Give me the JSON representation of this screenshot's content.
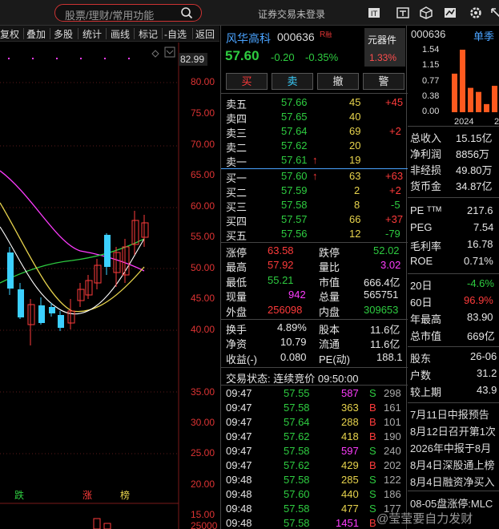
{
  "topbar": {
    "search_placeholder": "股票/理财/常用功能",
    "login_status": "证券交易未登录",
    "icons": [
      "brand-icon",
      "text-icon",
      "cube-icon",
      "chart-icon",
      "settings-icon",
      "expand-icon"
    ]
  },
  "chart_toolbar": {
    "items": [
      "复权",
      "叠加",
      "多股",
      "统计",
      "画线",
      "标记",
      "-自选",
      "返回"
    ]
  },
  "chart": {
    "top_price": "82.99",
    "price_labels": [
      "80.00",
      "75.00",
      "70.00",
      "65.00",
      "60.00",
      "55.00",
      "50.00",
      "45.00",
      "40.00",
      "35.00",
      "30.00",
      "25.00",
      "20.00",
      "15.00"
    ],
    "volume_label": "25000",
    "markers": {
      "die": "跌",
      "zhang": "涨",
      "bang": "榜"
    }
  },
  "quote": {
    "name": "风华高科",
    "code": "000636",
    "badge": "R",
    "sector_name": "元器件",
    "sector_pct": "1.33%",
    "price": "57.60",
    "change": "-0.20",
    "change_pct": "-0.35%",
    "actions": [
      "买",
      "卖",
      "撤",
      "警"
    ],
    "sell": [
      {
        "label": "卖五",
        "price": "57.66",
        "vol": "45",
        "delta": "+45"
      },
      {
        "label": "卖四",
        "price": "57.65",
        "vol": "40",
        "delta": ""
      },
      {
        "label": "卖三",
        "price": "57.64",
        "vol": "69",
        "delta": "+2"
      },
      {
        "label": "卖二",
        "price": "57.62",
        "vol": "20",
        "delta": ""
      },
      {
        "label": "卖一",
        "price": "57.61",
        "vol": "19",
        "delta": ""
      }
    ],
    "buy": [
      {
        "label": "买一",
        "price": "57.60",
        "vol": "63",
        "delta": "+63"
      },
      {
        "label": "买二",
        "price": "57.59",
        "vol": "2",
        "delta": "+2"
      },
      {
        "label": "买三",
        "price": "57.58",
        "vol": "8",
        "delta": "-5"
      },
      {
        "label": "买四",
        "price": "57.57",
        "vol": "66",
        "delta": "+37"
      },
      {
        "label": "买五",
        "price": "57.56",
        "vol": "12",
        "delta": "-79"
      }
    ],
    "stats": [
      {
        "l1": "涨停",
        "v1": "63.58",
        "l2": "跌停",
        "v2": "52.02"
      },
      {
        "l1": "最高",
        "v1": "57.92",
        "l2": "量比",
        "v2": "3.02"
      },
      {
        "l1": "最低",
        "v1": "55.21",
        "l2": "市值",
        "v2": "666.4亿"
      },
      {
        "l1": "现量",
        "v1": "942",
        "l2": "总量",
        "v2": "565751"
      },
      {
        "l1": "外盘",
        "v1": "256098",
        "l2": "内盘",
        "v2": "309653"
      }
    ],
    "stats2": [
      {
        "l1": "换手",
        "v1": "4.89%",
        "l2": "股本",
        "v2": "11.6亿"
      },
      {
        "l1": "净资",
        "v1": "10.79",
        "l2": "流通",
        "v2": "11.6亿"
      },
      {
        "l1": "收益(-)",
        "v1": "0.080",
        "l2": "PE(动)",
        "v2": "188.1"
      }
    ],
    "trade_status": "交易状态: 连续竞价 09:50:00",
    "ticks": [
      {
        "t": "09:47",
        "p": "57.55",
        "v": "587",
        "s": "S",
        "n": "298"
      },
      {
        "t": "09:47",
        "p": "57.58",
        "v": "363",
        "s": "B",
        "n": "161"
      },
      {
        "t": "09:47",
        "p": "57.64",
        "v": "288",
        "s": "B",
        "n": "101"
      },
      {
        "t": "09:47",
        "p": "57.62",
        "v": "418",
        "s": "B",
        "n": "190"
      },
      {
        "t": "09:47",
        "p": "57.58",
        "v": "597",
        "s": "S",
        "n": "240"
      },
      {
        "t": "09:47",
        "p": "57.62",
        "v": "429",
        "s": "B",
        "n": "202"
      },
      {
        "t": "09:48",
        "p": "57.58",
        "v": "285",
        "s": "S",
        "n": "122"
      },
      {
        "t": "09:48",
        "p": "57.60",
        "v": "440",
        "s": "S",
        "n": "186"
      },
      {
        "t": "09:48",
        "p": "57.58",
        "v": "477",
        "s": "S",
        "n": "177"
      },
      {
        "t": "09:48",
        "p": "57.58",
        "v": "1451",
        "s": "B",
        "n": ""
      }
    ]
  },
  "right": {
    "code": "000636",
    "period": "单季",
    "bar_labels": [
      "1.54",
      "1.15",
      "0.77",
      "0.38",
      "0.00"
    ],
    "bar_values": [
      0.95,
      1.54,
      0.6,
      0.5,
      0.2,
      0.65
    ],
    "year_label": "2024",
    "year_label2": "2",
    "fin": [
      {
        "l": "总收入",
        "v": "15.15亿"
      },
      {
        "l": "净利润",
        "v": "8856万"
      },
      {
        "l": "非经损",
        "v": "49.80万"
      },
      {
        "l": "货币金",
        "v": "34.87亿"
      }
    ],
    "val": [
      {
        "l": "PE ᵀᵀᴹ",
        "v": "217.6"
      },
      {
        "l": "PEG",
        "v": "7.54"
      },
      {
        "l": "毛利率",
        "v": "16.78"
      },
      {
        "l": "ROE",
        "v": "0.71%"
      }
    ],
    "perf": [
      {
        "l": "20日",
        "v": "-4.6%"
      },
      {
        "l": "60日",
        "v": "96.9%"
      },
      {
        "l": "年最高",
        "v": "83.90"
      },
      {
        "l": "总市值",
        "v": "669亿"
      }
    ],
    "holders": [
      {
        "l": "股东",
        "v": "26-06"
      },
      {
        "l": "户数",
        "v": "31.2"
      },
      {
        "l": "较上期",
        "v": "43.9"
      }
    ],
    "news": [
      "7月11日中报预告",
      "8月12日召开第1次",
      "2026年中报于8月",
      "8月4日深股通上榜",
      "8月4日融资净买入",
      "08-05盘涨停:MLC"
    ]
  },
  "watermark": "@莹莹要自力发财"
}
